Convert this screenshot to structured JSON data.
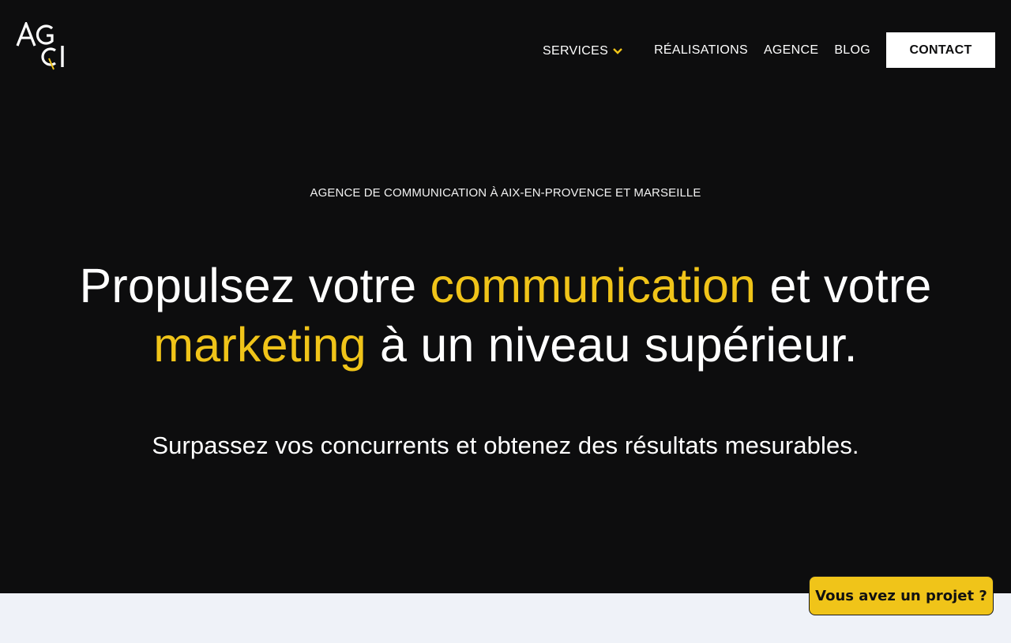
{
  "brand": {
    "logo_text": "AGCI",
    "accent_color": "#f0c419",
    "background_color": "#0d0d0e"
  },
  "nav": {
    "services": "SERVICES",
    "realisations": "RÉALISATIONS",
    "agence": "AGENCE",
    "blog": "BLOG",
    "contact": "CONTACT"
  },
  "hero": {
    "eyebrow": "AGENCE DE COMMUNICATION À AIX-EN-PROVENCE ET MARSEILLE",
    "headline": {
      "part1": "Propulsez votre ",
      "accent1": "communication",
      "part2": " et votre",
      "accent2": "marketing",
      "part3": " à un niveau supérieur."
    },
    "subtitle": "Surpassez vos concurrents et obtenez des résultats mesurables."
  },
  "cta": {
    "project_button": "Vous avez un projet ?"
  }
}
